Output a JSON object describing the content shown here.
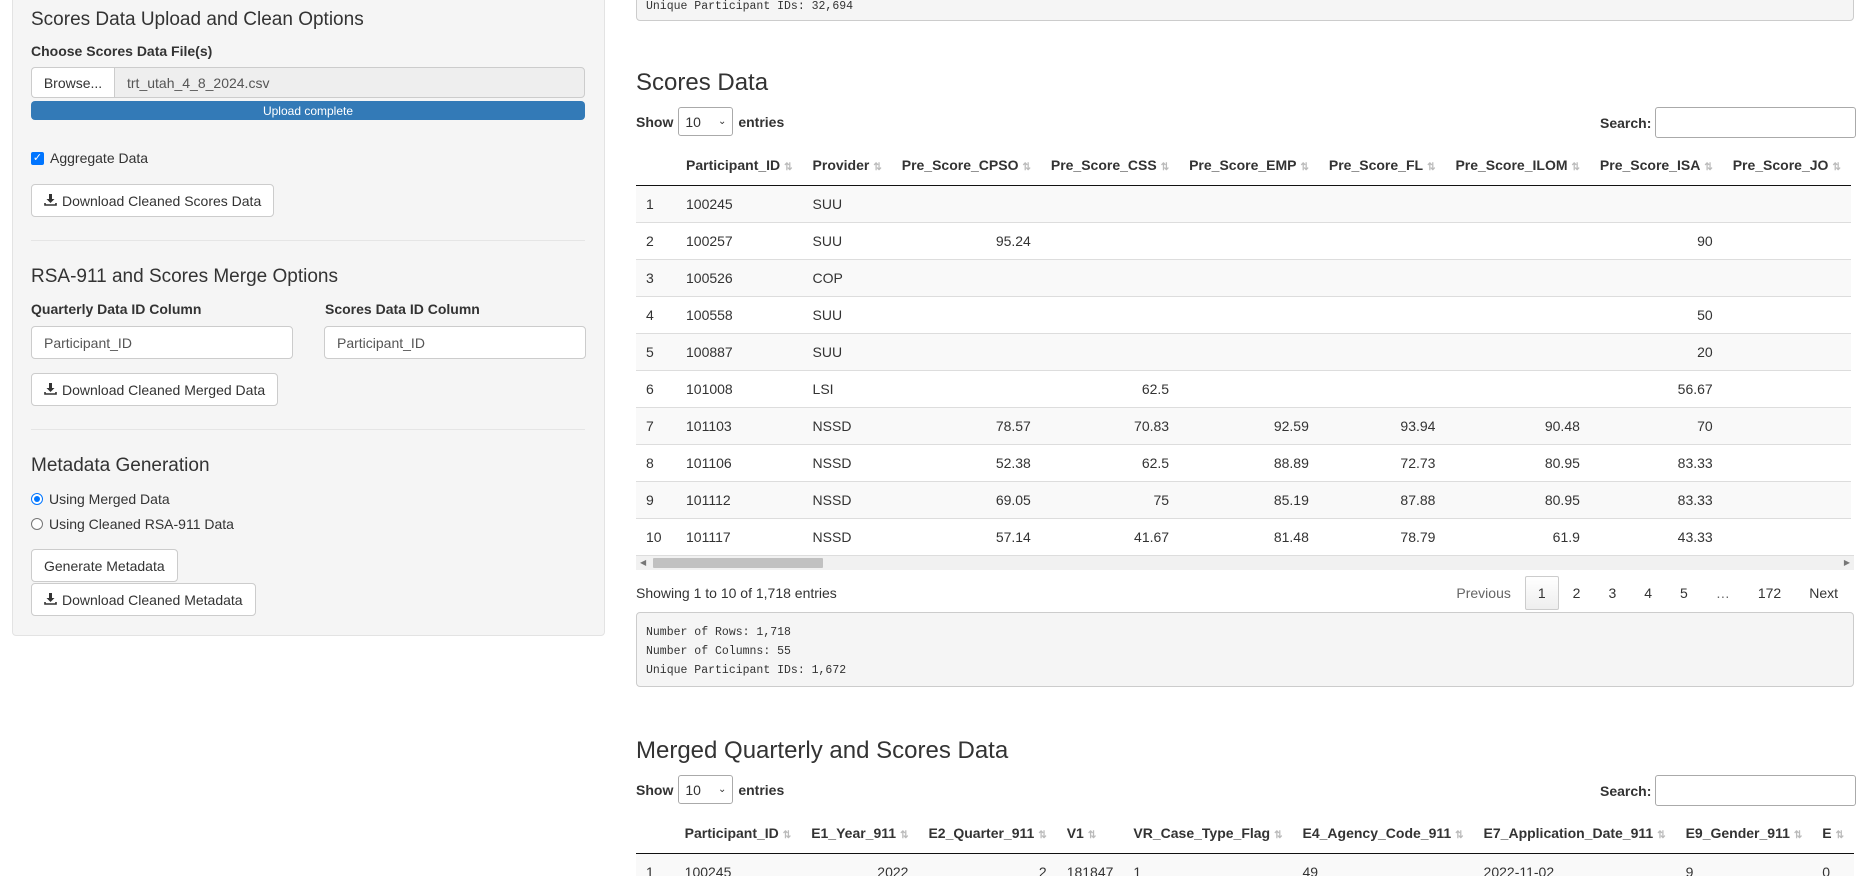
{
  "sidebar": {
    "scores_heading": "Scores Data Upload and Clean Options",
    "choose_label": "Choose Scores Data File(s)",
    "browse_label": "Browse...",
    "file_name": "trt_utah_4_8_2024.csv",
    "progress_text": "Upload complete",
    "aggregate_label": "Aggregate Data",
    "download_scores_label": "Download Cleaned Scores Data",
    "merge_heading": "RSA-911 and Scores Merge Options",
    "quarterly_id_label": "Quarterly Data ID Column",
    "quarterly_id_value": "Participant_ID",
    "scores_id_label": "Scores Data ID Column",
    "scores_id_value": "Participant_ID",
    "download_merged_label": "Download Cleaned Merged Data",
    "metadata_heading": "Metadata Generation",
    "radio_merged": "Using Merged Data",
    "radio_rsa": "Using Cleaned RSA-911 Data",
    "generate_label": "Generate Metadata",
    "download_metadata_label": "Download Cleaned Metadata"
  },
  "top_well": {
    "line": "Unique Participant IDs: 32,694"
  },
  "scores": {
    "title": "Scores Data",
    "show_label": "Show",
    "entries_label": "entries",
    "page_size": "10",
    "search_label": "Search:",
    "columns": [
      "",
      "Participant_ID",
      "Provider",
      "Pre_Score_CPSO",
      "Pre_Score_CSS",
      "Pre_Score_EMP",
      "Pre_Score_FL",
      "Pre_Score_ILOM",
      "Pre_Score_ISA",
      "Pre_Score_JO"
    ],
    "rows": [
      [
        "1",
        "100245",
        "SUU",
        "",
        "",
        "",
        "",
        "",
        "",
        ""
      ],
      [
        "2",
        "100257",
        "SUU",
        "95.24",
        "",
        "",
        "",
        "",
        "90",
        ""
      ],
      [
        "3",
        "100526",
        "COP",
        "",
        "",
        "",
        "",
        "",
        "",
        ""
      ],
      [
        "4",
        "100558",
        "SUU",
        "",
        "",
        "",
        "",
        "",
        "50",
        ""
      ],
      [
        "5",
        "100887",
        "SUU",
        "",
        "",
        "",
        "",
        "",
        "20",
        ""
      ],
      [
        "6",
        "101008",
        "LSI",
        "",
        "62.5",
        "",
        "",
        "",
        "56.67",
        ""
      ],
      [
        "7",
        "101103",
        "NSSD",
        "78.57",
        "70.83",
        "92.59",
        "93.94",
        "90.48",
        "70",
        ""
      ],
      [
        "8",
        "101106",
        "NSSD",
        "52.38",
        "62.5",
        "88.89",
        "72.73",
        "80.95",
        "83.33",
        ""
      ],
      [
        "9",
        "101112",
        "NSSD",
        "69.05",
        "75",
        "85.19",
        "87.88",
        "80.95",
        "83.33",
        ""
      ],
      [
        "10",
        "101117",
        "NSSD",
        "57.14",
        "41.67",
        "81.48",
        "78.79",
        "61.9",
        "43.33",
        ""
      ]
    ],
    "info": "Showing 1 to 10 of 1,718 entries",
    "pager": {
      "previous": "Previous",
      "pages": [
        "1",
        "2",
        "3",
        "4",
        "5",
        "…",
        "172"
      ],
      "next": "Next"
    },
    "summary": {
      "rows": "Number of Rows: 1,718",
      "cols": "Number of Columns: 55",
      "ids": "Unique Participant IDs: 1,672"
    }
  },
  "merged": {
    "title": "Merged Quarterly and Scores Data",
    "show_label": "Show",
    "entries_label": "entries",
    "page_size": "10",
    "search_label": "Search:",
    "columns": [
      "",
      "Participant_ID",
      "E1_Year_911",
      "E2_Quarter_911",
      "V1",
      "VR_Case_Type_Flag",
      "E4_Agency_Code_911",
      "E7_Application_Date_911",
      "E9_Gender_911",
      "E"
    ],
    "rows": [
      [
        "1",
        "100245",
        "2022",
        "2",
        "181847",
        "1",
        "49",
        "2022-11-02",
        "9",
        "0"
      ]
    ]
  }
}
